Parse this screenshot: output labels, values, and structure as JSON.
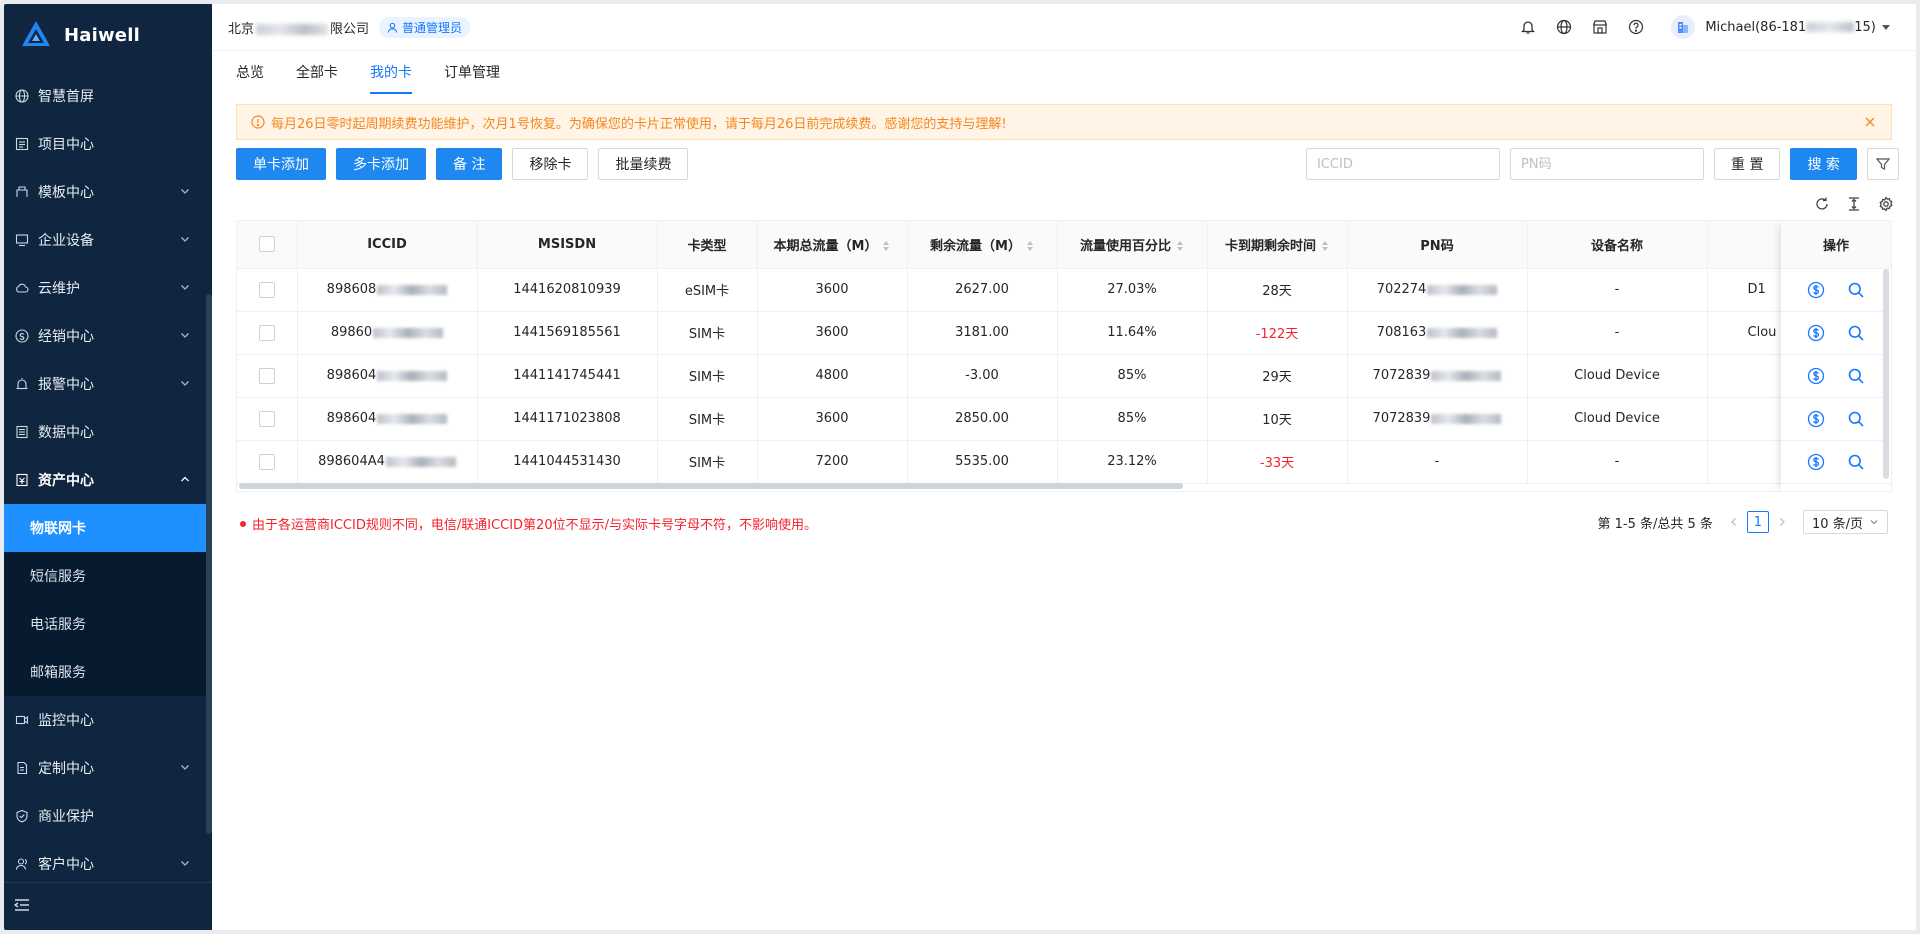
{
  "brand": {
    "name": "Haiwell",
    "logo_sub": "Haiwell"
  },
  "header": {
    "company_prefix": "北京",
    "company_suffix": "限公司",
    "role": "普通管理员",
    "user_prefix": "Michael(86-181",
    "user_suffix": "15)"
  },
  "sidebar": {
    "items": [
      {
        "label": "智慧首屏",
        "icon": "globe-icon",
        "chevron": false
      },
      {
        "label": "项目中心",
        "icon": "list-icon",
        "chevron": false
      },
      {
        "label": "模板中心",
        "icon": "template-icon",
        "chevron": true
      },
      {
        "label": "企业设备",
        "icon": "monitor-icon",
        "chevron": true
      },
      {
        "label": "云维护",
        "icon": "cloud-icon",
        "chevron": true
      },
      {
        "label": "经销中心",
        "icon": "dealer-icon",
        "chevron": true
      },
      {
        "label": "报警中心",
        "icon": "alarm-icon",
        "chevron": true
      },
      {
        "label": "数据中心",
        "icon": "data-icon",
        "chevron": false
      },
      {
        "label": "资产中心",
        "icon": "asset-icon",
        "chevron": true,
        "open": true
      }
    ],
    "submenu": [
      "物联网卡",
      "短信服务",
      "电话服务",
      "邮箱服务"
    ],
    "items_after": [
      {
        "label": "监控中心",
        "icon": "camera-icon",
        "chevron": false
      },
      {
        "label": "定制中心",
        "icon": "custom-icon",
        "chevron": true
      },
      {
        "label": "商业保护",
        "icon": "shield-icon",
        "chevron": false
      },
      {
        "label": "客户中心",
        "icon": "customer-icon",
        "chevron": true
      }
    ]
  },
  "tabs": [
    "总览",
    "全部卡",
    "我的卡",
    "订单管理"
  ],
  "active_tab": "我的卡",
  "alert": "每月26日零时起周期续费功能维护，次月1号恢复。为确保您的卡片正常使用，请于每月26日前完成续费。感谢您的支持与理解!",
  "toolbar": {
    "single_add": "单卡添加",
    "multi_add": "多卡添加",
    "remark": "备 注",
    "remove": "移除卡",
    "batch_renew": "批量续费"
  },
  "search": {
    "iccid_placeholder": "ICCID",
    "pn_placeholder": "PN码",
    "reset": "重 置",
    "search": "搜 索"
  },
  "table": {
    "columns": [
      "ICCID",
      "MSISDN",
      "卡类型",
      "本期总流量（M）",
      "剩余流量（M）",
      "流量使用百分比",
      "卡到期剩余时间",
      "PN码",
      "设备名称",
      "设"
    ],
    "ops_header": "操作",
    "rows": [
      {
        "iccid": "898608",
        "msisdn": "1441620810939",
        "type": "eSIM卡",
        "total": "3600",
        "remain": "2627.00",
        "percent": "27.03%",
        "expire": "28天",
        "expired": false,
        "pn": "702274",
        "device": "-",
        "extra": "D1"
      },
      {
        "iccid": "89860",
        "msisdn": "1441569185561",
        "type": "SIM卡",
        "total": "3600",
        "remain": "3181.00",
        "percent": "11.64%",
        "expire": "-122天",
        "expired": true,
        "pn": "708163",
        "device": "-",
        "extra": "Clou"
      },
      {
        "iccid": "898604",
        "msisdn": "1441141745441",
        "type": "SIM卡",
        "total": "4800",
        "remain": "-3.00",
        "percent": "85%",
        "expire": "29天",
        "expired": false,
        "pn": "7072839",
        "device": "Cloud Device",
        "extra": ""
      },
      {
        "iccid": "898604",
        "msisdn": "1441171023808",
        "type": "SIM卡",
        "total": "3600",
        "remain": "2850.00",
        "percent": "85%",
        "expire": "10天",
        "expired": false,
        "pn": "7072839",
        "device": "Cloud Device",
        "extra": ""
      },
      {
        "iccid": "898604A4",
        "msisdn": "1441044531430",
        "type": "SIM卡",
        "total": "7200",
        "remain": "5535.00",
        "percent": "23.12%",
        "expire": "-33天",
        "expired": true,
        "pn": "-",
        "device": "-",
        "extra": ""
      }
    ]
  },
  "note": "由于各运营商ICCID规则不同，电信/联通ICCID第20位不显示/与实际卡号字母不符，不影响使用。",
  "pagination": {
    "summary": "第 1-5 条/总共 5 条",
    "page": "1",
    "page_size": "10 条/页"
  },
  "colors": {
    "sidebar_bg": "#0f2540",
    "accent": "#1677ff",
    "warning": "#f5871f",
    "danger": "#f5222d"
  }
}
